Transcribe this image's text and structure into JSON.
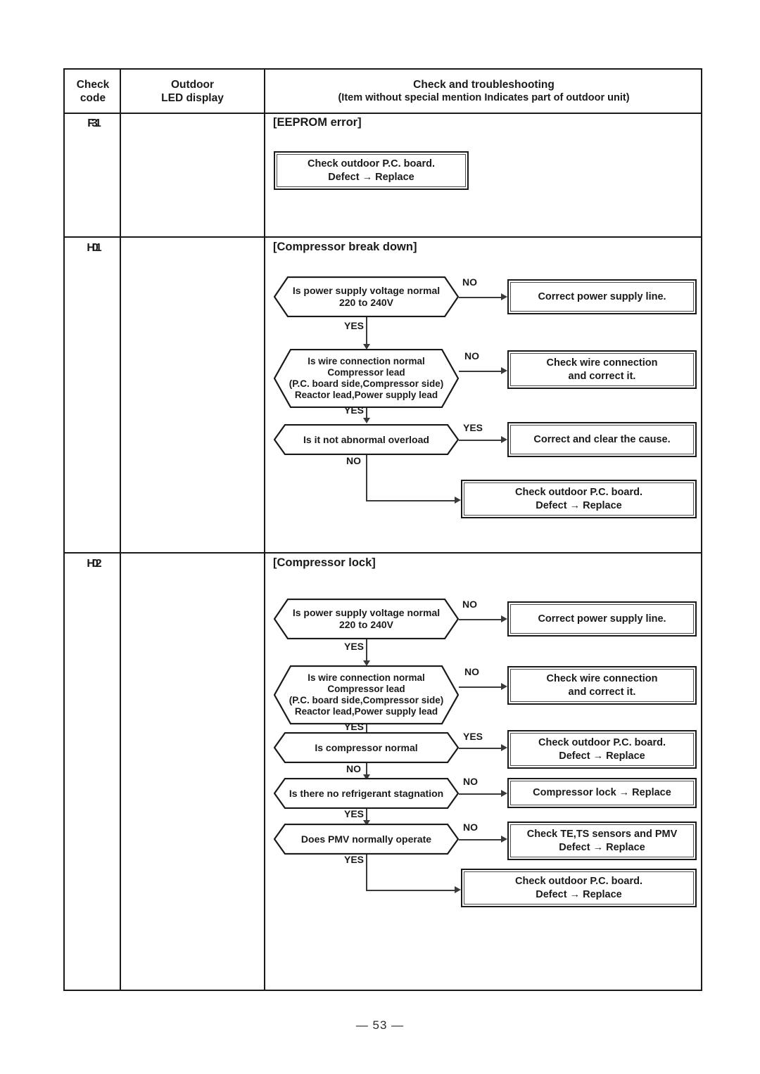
{
  "page": {
    "footer": "— 53 —"
  },
  "table": {
    "header": {
      "col_check_code_line1": "Check",
      "col_check_code_line2": "code",
      "col_led_line1": "Outdoor",
      "col_led_line2": "LED display",
      "col_trouble_line1": "Check and troubleshooting",
      "col_trouble_line2": "(Item without special mention Indicates part of outdoor unit)"
    },
    "rows": [
      {
        "check_code": "F31",
        "led_display": "",
        "title": "[EEPROM error]",
        "flow": {
          "boxes": [
            {
              "id": "eeprom-pcb",
              "lines": [
                "Check outdoor P.C. board.",
                "Defect → Replace"
              ]
            }
          ]
        }
      },
      {
        "check_code": "H01",
        "led_display": "",
        "title": "[Compressor break down]",
        "flow": {
          "decisions": [
            {
              "id": "power-voltage",
              "lines": [
                "Is power supply voltage normal",
                "220 to 240V"
              ],
              "branch": "NO"
            },
            {
              "id": "wire-connection",
              "lines": [
                "Is wire connection normal",
                "Compressor lead",
                "(P.C. board side,Compressor side)",
                "Reactor lead,Power supply lead"
              ],
              "branch": "NO"
            },
            {
              "id": "abnormal-overload",
              "lines": [
                "Is it not abnormal overload"
              ],
              "branch": "YES"
            }
          ],
          "boxes": [
            {
              "id": "correct-power-line",
              "lines": [
                "Correct power supply line."
              ]
            },
            {
              "id": "check-wire",
              "lines": [
                "Check wire connection",
                "and correct it."
              ]
            },
            {
              "id": "correct-clear-cause",
              "lines": [
                "Correct and clear the cause."
              ]
            },
            {
              "id": "check-pcb",
              "lines": [
                "Check outdoor P.C. board.",
                "Defect → Replace"
              ]
            }
          ],
          "yes_label": "YES",
          "no_label": "NO"
        }
      },
      {
        "check_code": "H02",
        "led_display": "",
        "title": "[Compressor lock]",
        "flow": {
          "decisions": [
            {
              "id": "power-voltage",
              "lines": [
                "Is power supply voltage normal",
                "220 to 240V"
              ],
              "branch": "NO"
            },
            {
              "id": "wire-connection",
              "lines": [
                "Is wire connection normal",
                "Compressor lead",
                "(P.C. board side,Compressor side)",
                "Reactor lead,Power supply lead"
              ],
              "branch": "NO"
            },
            {
              "id": "compressor-normal",
              "lines": [
                "Is compressor normal"
              ],
              "branch": "YES"
            },
            {
              "id": "refrigerant-stagnation",
              "lines": [
                "Is there no refrigerant stagnation"
              ],
              "branch": "NO"
            },
            {
              "id": "pmv-operate",
              "lines": [
                "Does PMV normally operate"
              ],
              "branch": "NO"
            }
          ],
          "boxes": [
            {
              "id": "correct-power-line",
              "lines": [
                "Correct power supply line."
              ]
            },
            {
              "id": "check-wire",
              "lines": [
                "Check wire connection",
                "and correct it."
              ]
            },
            {
              "id": "check-pcb-1",
              "lines": [
                "Check outdoor P.C. board.",
                "Defect → Replace"
              ]
            },
            {
              "id": "compressor-lock-replace",
              "lines": [
                "Compressor lock → Replace"
              ]
            },
            {
              "id": "check-sensors",
              "lines": [
                "Check TE,TS sensors and PMV",
                "Defect → Replace"
              ]
            },
            {
              "id": "check-pcb-2",
              "lines": [
                "Check outdoor P.C. board.",
                "Defect → Replace"
              ]
            }
          ],
          "yes_label": "YES",
          "no_label": "NO"
        }
      }
    ]
  },
  "colors": {
    "rule": "#1a1a1a",
    "connector": "#3a3a3a",
    "text": "#1a1a1a"
  }
}
